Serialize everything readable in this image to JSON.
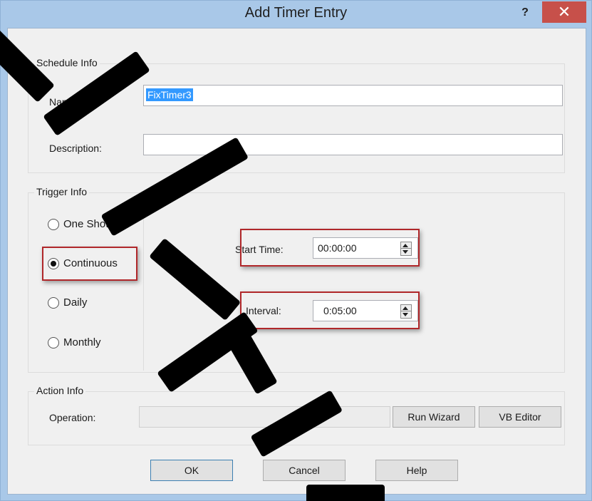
{
  "window": {
    "title": "Add Timer Entry",
    "help_glyph": "?",
    "close_glyph": "✕"
  },
  "schedule": {
    "group_label": "Schedule Info",
    "name_label": "Name:",
    "name_value": "FixTimer3",
    "description_label": "Description:",
    "description_value": ""
  },
  "trigger": {
    "group_label": "Trigger Info",
    "options": [
      {
        "label": "One Shot",
        "checked": false
      },
      {
        "label": "Continuous",
        "checked": true
      },
      {
        "label": "Daily",
        "checked": false
      },
      {
        "label": "Monthly",
        "checked": false
      }
    ],
    "start_time_label": "Start Time:",
    "start_time_value": "00:00:00",
    "interval_label": "Interval:",
    "interval_value": "0:05:00"
  },
  "action": {
    "group_label": "Action Info",
    "operation_label": "Operation:",
    "operation_value": "",
    "run_wizard_label": "Run Wizard",
    "vb_editor_label": "VB Editor"
  },
  "footer": {
    "ok_label": "OK",
    "cancel_label": "Cancel",
    "help_label": "Help"
  },
  "highlight_color": "#b0272a"
}
